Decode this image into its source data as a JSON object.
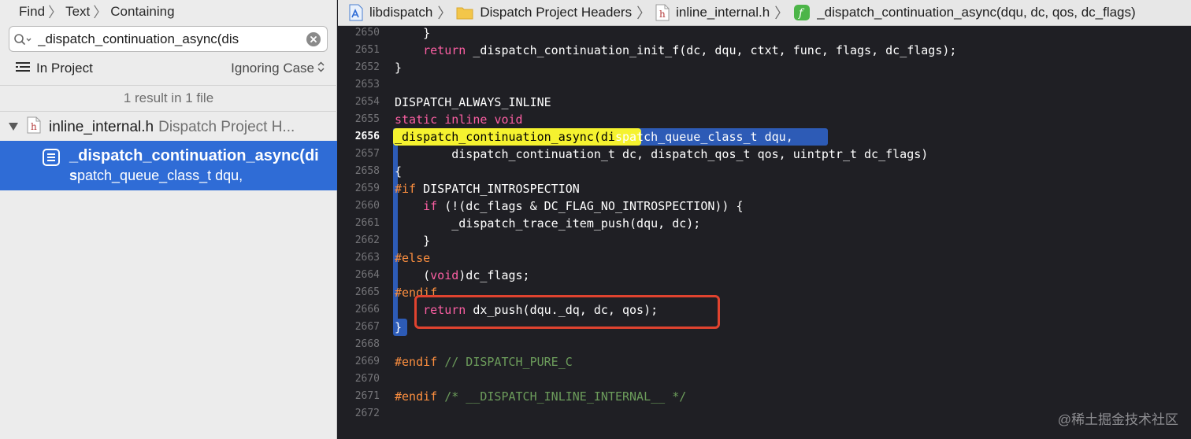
{
  "navigator": {
    "find_mode": {
      "find": "Find",
      "text": "Text",
      "containing": "Containing"
    },
    "search": {
      "value": "_dispatch_continuation_async(dis"
    },
    "scope": "In Project",
    "case_option": "Ignoring Case",
    "summary": "1 result in 1 file",
    "file": {
      "name": "inline_internal.h",
      "group": "Dispatch Project H..."
    },
    "result": {
      "line1": "_dispatch_continuation_async(di",
      "line2_match": "s",
      "line2_rest": "patch_queue_class_t dqu,"
    }
  },
  "jumpbar": {
    "project": "libdispatch",
    "group": "Dispatch Project Headers",
    "file": "inline_internal.h",
    "symbol": "_dispatch_continuation_async(dqu, dc, qos, dc_flags)"
  },
  "code": {
    "lines": [
      {
        "n": "2650",
        "text": "    }"
      },
      {
        "n": "2651",
        "text": "    return _dispatch_continuation_init_f(dc, dqu, ctxt, func, flags, dc_flags);"
      },
      {
        "n": "2652",
        "text": "}"
      },
      {
        "n": "2653",
        "text": ""
      },
      {
        "n": "2654",
        "text": "DISPATCH_ALWAYS_INLINE"
      },
      {
        "n": "2655",
        "text": "static inline void"
      },
      {
        "n": "2656",
        "text": "_dispatch_continuation_async(dispatch_queue_class_t dqu,"
      },
      {
        "n": "2657",
        "text": "        dispatch_continuation_t dc, dispatch_qos_t qos, uintptr_t dc_flags)"
      },
      {
        "n": "2658",
        "text": "{"
      },
      {
        "n": "2659",
        "text": "#if DISPATCH_INTROSPECTION"
      },
      {
        "n": "2660",
        "text": "    if (!(dc_flags & DC_FLAG_NO_INTROSPECTION)) {"
      },
      {
        "n": "2661",
        "text": "        _dispatch_trace_item_push(dqu, dc);"
      },
      {
        "n": "2662",
        "text": "    }"
      },
      {
        "n": "2663",
        "text": "#else"
      },
      {
        "n": "2664",
        "text": "    (void)dc_flags;"
      },
      {
        "n": "2665",
        "text": "#endif"
      },
      {
        "n": "2666",
        "text": "    return dx_push(dqu._dq, dc, qos);"
      },
      {
        "n": "2667",
        "text": "}"
      },
      {
        "n": "2668",
        "text": ""
      },
      {
        "n": "2669",
        "text": "#endif // DISPATCH_PURE_C"
      },
      {
        "n": "2670",
        "text": ""
      },
      {
        "n": "2671",
        "text": "#endif /* __DISPATCH_INLINE_INTERNAL__ */"
      },
      {
        "n": "2672",
        "text": ""
      }
    ],
    "current_line": "2656"
  },
  "watermark": "@稀土掘金技术社区",
  "colors": {
    "keyword": "#fc5fa3",
    "preprocessor": "#fd8f3f",
    "comment": "#6c9c5b",
    "selection": "#2f6cd6",
    "match_highlight": "#f5f22f",
    "annotation_box": "#e0432f"
  }
}
